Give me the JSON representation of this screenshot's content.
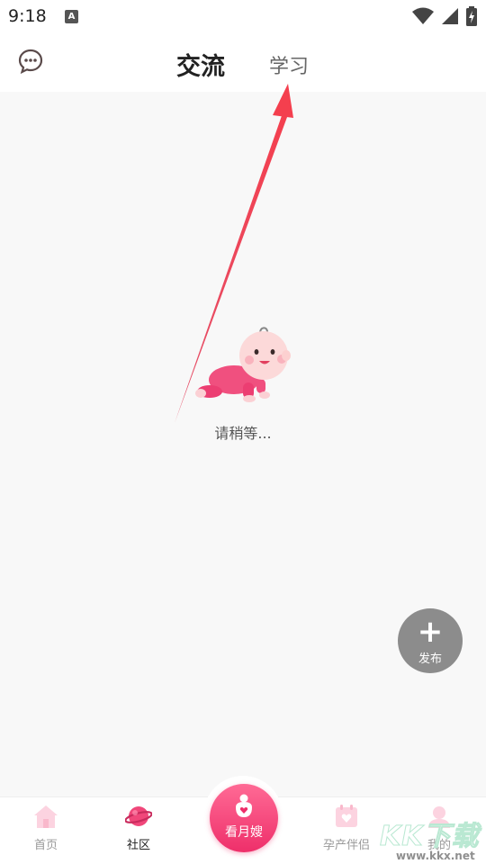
{
  "status_bar": {
    "time": "9:18",
    "notification_icon": "a-letter-icon",
    "icons": [
      "wifi-icon",
      "signal-icon",
      "battery-charging-icon"
    ]
  },
  "header": {
    "message_icon": "chat-bubble-icon",
    "tabs": [
      {
        "label": "交流",
        "active": true
      },
      {
        "label": "学习",
        "active": false
      }
    ]
  },
  "content": {
    "loading_image": "crawling-baby-illustration",
    "loading_text": "请稍等..."
  },
  "fab": {
    "icon": "plus-icon",
    "label": "发布"
  },
  "bottom_nav": {
    "items": [
      {
        "label": "首页",
        "icon": "home-icon",
        "active": false
      },
      {
        "label": "社区",
        "icon": "planet-icon",
        "active": true
      },
      {
        "label": "看月嫂",
        "icon": "nanny-icon",
        "active": false
      },
      {
        "label": "孕产伴侣",
        "icon": "calendar-heart-icon",
        "active": false
      },
      {
        "label": "我的",
        "icon": "profile-icon",
        "active": false
      }
    ]
  },
  "watermark": {
    "text": "KK下载",
    "url": "www.kkx.net"
  },
  "colors": {
    "accent": "#ee2f6a",
    "arrow": "#f03c5a",
    "fab": "#8c8c8c",
    "background": "#f8f8f8"
  }
}
